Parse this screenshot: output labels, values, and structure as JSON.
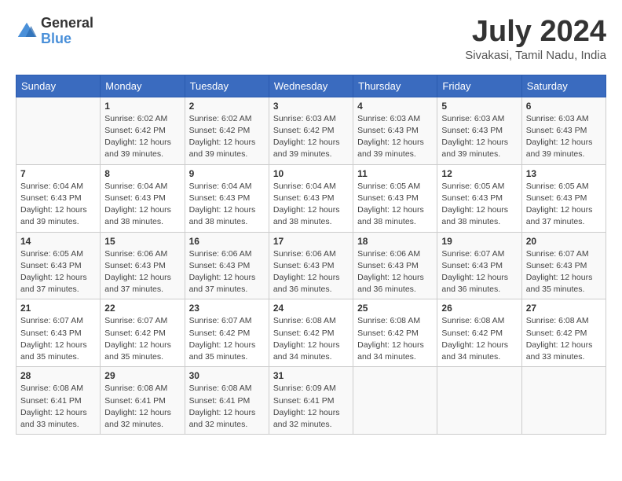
{
  "logo": {
    "general": "General",
    "blue": "Blue"
  },
  "title": "July 2024",
  "subtitle": "Sivakasi, Tamil Nadu, India",
  "days_header": [
    "Sunday",
    "Monday",
    "Tuesday",
    "Wednesday",
    "Thursday",
    "Friday",
    "Saturday"
  ],
  "weeks": [
    [
      {
        "day": "",
        "content": ""
      },
      {
        "day": "1",
        "content": "Sunrise: 6:02 AM\nSunset: 6:42 PM\nDaylight: 12 hours\nand 39 minutes."
      },
      {
        "day": "2",
        "content": "Sunrise: 6:02 AM\nSunset: 6:42 PM\nDaylight: 12 hours\nand 39 minutes."
      },
      {
        "day": "3",
        "content": "Sunrise: 6:03 AM\nSunset: 6:42 PM\nDaylight: 12 hours\nand 39 minutes."
      },
      {
        "day": "4",
        "content": "Sunrise: 6:03 AM\nSunset: 6:43 PM\nDaylight: 12 hours\nand 39 minutes."
      },
      {
        "day": "5",
        "content": "Sunrise: 6:03 AM\nSunset: 6:43 PM\nDaylight: 12 hours\nand 39 minutes."
      },
      {
        "day": "6",
        "content": "Sunrise: 6:03 AM\nSunset: 6:43 PM\nDaylight: 12 hours\nand 39 minutes."
      }
    ],
    [
      {
        "day": "7",
        "content": "Sunrise: 6:04 AM\nSunset: 6:43 PM\nDaylight: 12 hours\nand 39 minutes."
      },
      {
        "day": "8",
        "content": "Sunrise: 6:04 AM\nSunset: 6:43 PM\nDaylight: 12 hours\nand 38 minutes."
      },
      {
        "day": "9",
        "content": "Sunrise: 6:04 AM\nSunset: 6:43 PM\nDaylight: 12 hours\nand 38 minutes."
      },
      {
        "day": "10",
        "content": "Sunrise: 6:04 AM\nSunset: 6:43 PM\nDaylight: 12 hours\nand 38 minutes."
      },
      {
        "day": "11",
        "content": "Sunrise: 6:05 AM\nSunset: 6:43 PM\nDaylight: 12 hours\nand 38 minutes."
      },
      {
        "day": "12",
        "content": "Sunrise: 6:05 AM\nSunset: 6:43 PM\nDaylight: 12 hours\nand 38 minutes."
      },
      {
        "day": "13",
        "content": "Sunrise: 6:05 AM\nSunset: 6:43 PM\nDaylight: 12 hours\nand 37 minutes."
      }
    ],
    [
      {
        "day": "14",
        "content": "Sunrise: 6:05 AM\nSunset: 6:43 PM\nDaylight: 12 hours\nand 37 minutes."
      },
      {
        "day": "15",
        "content": "Sunrise: 6:06 AM\nSunset: 6:43 PM\nDaylight: 12 hours\nand 37 minutes."
      },
      {
        "day": "16",
        "content": "Sunrise: 6:06 AM\nSunset: 6:43 PM\nDaylight: 12 hours\nand 37 minutes."
      },
      {
        "day": "17",
        "content": "Sunrise: 6:06 AM\nSunset: 6:43 PM\nDaylight: 12 hours\nand 36 minutes."
      },
      {
        "day": "18",
        "content": "Sunrise: 6:06 AM\nSunset: 6:43 PM\nDaylight: 12 hours\nand 36 minutes."
      },
      {
        "day": "19",
        "content": "Sunrise: 6:07 AM\nSunset: 6:43 PM\nDaylight: 12 hours\nand 36 minutes."
      },
      {
        "day": "20",
        "content": "Sunrise: 6:07 AM\nSunset: 6:43 PM\nDaylight: 12 hours\nand 35 minutes."
      }
    ],
    [
      {
        "day": "21",
        "content": "Sunrise: 6:07 AM\nSunset: 6:43 PM\nDaylight: 12 hours\nand 35 minutes."
      },
      {
        "day": "22",
        "content": "Sunrise: 6:07 AM\nSunset: 6:42 PM\nDaylight: 12 hours\nand 35 minutes."
      },
      {
        "day": "23",
        "content": "Sunrise: 6:07 AM\nSunset: 6:42 PM\nDaylight: 12 hours\nand 35 minutes."
      },
      {
        "day": "24",
        "content": "Sunrise: 6:08 AM\nSunset: 6:42 PM\nDaylight: 12 hours\nand 34 minutes."
      },
      {
        "day": "25",
        "content": "Sunrise: 6:08 AM\nSunset: 6:42 PM\nDaylight: 12 hours\nand 34 minutes."
      },
      {
        "day": "26",
        "content": "Sunrise: 6:08 AM\nSunset: 6:42 PM\nDaylight: 12 hours\nand 34 minutes."
      },
      {
        "day": "27",
        "content": "Sunrise: 6:08 AM\nSunset: 6:42 PM\nDaylight: 12 hours\nand 33 minutes."
      }
    ],
    [
      {
        "day": "28",
        "content": "Sunrise: 6:08 AM\nSunset: 6:41 PM\nDaylight: 12 hours\nand 33 minutes."
      },
      {
        "day": "29",
        "content": "Sunrise: 6:08 AM\nSunset: 6:41 PM\nDaylight: 12 hours\nand 32 minutes."
      },
      {
        "day": "30",
        "content": "Sunrise: 6:08 AM\nSunset: 6:41 PM\nDaylight: 12 hours\nand 32 minutes."
      },
      {
        "day": "31",
        "content": "Sunrise: 6:09 AM\nSunset: 6:41 PM\nDaylight: 12 hours\nand 32 minutes."
      },
      {
        "day": "",
        "content": ""
      },
      {
        "day": "",
        "content": ""
      },
      {
        "day": "",
        "content": ""
      }
    ]
  ]
}
